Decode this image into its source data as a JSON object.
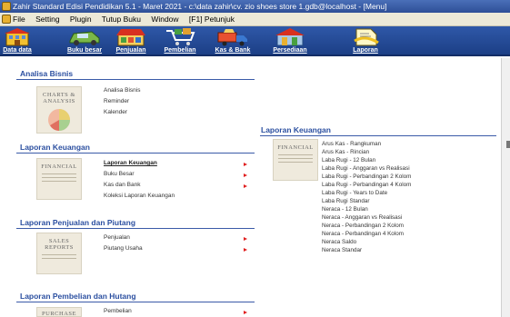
{
  "window": {
    "title": "Zahir Standard Edisi Pendidikan 5.1 - Maret 2021 - c:\\data zahir\\cv. zio shoes store 1.gdb@localhost - [Menu]"
  },
  "menu": [
    "File",
    "Setting",
    "Plugin",
    "Tutup Buku",
    "Window",
    "[F1] Petunjuk"
  ],
  "toolbar": [
    {
      "label": "Data data",
      "icon": "building-icon"
    },
    {
      "label": "Buku besar",
      "icon": "car-icon"
    },
    {
      "label": "Penjualan",
      "icon": "shop-icon"
    },
    {
      "label": "Pembelian",
      "icon": "cart-icon"
    },
    {
      "label": "Kas & Bank",
      "icon": "truck-icon"
    },
    {
      "label": "Persediaan",
      "icon": "warehouse-icon"
    },
    {
      "label": "Laporan",
      "icon": "document-icon"
    }
  ],
  "sections": {
    "analisa": {
      "title": "Analisa Bisnis",
      "thumb": "CHARTS & ANALYSIS",
      "items": [
        "Analisa Bisnis",
        "Reminder",
        "Kalender"
      ]
    },
    "keuangan": {
      "title": "Laporan Keuangan",
      "thumb": "FINANCIAL",
      "items": [
        "Laporan Keuangan",
        "Buku Besar",
        "Kas dan Bank",
        "Koleksi Laporan Keuangan"
      ]
    },
    "penjualan": {
      "title": "Laporan Penjualan dan Piutang",
      "thumb": "SALES REPORTS",
      "items": [
        "Penjualan",
        "Piutang Usaha"
      ]
    },
    "pembelian": {
      "title": "Laporan Pembelian dan Hutang",
      "thumb": "PURCHASE",
      "items": [
        "Pembelian"
      ]
    },
    "keuangan_right": {
      "title": "Laporan Keuangan",
      "thumb": "FINANCIAL",
      "items": [
        "Arus Kas - Rangkuman",
        "Arus Kas - Rincian",
        "Laba Rugi - 12 Bulan",
        "Laba Rugi - Anggaran vs Realisasi",
        "Laba Rugi - Perbandingan 2 Kolom",
        "Laba Rugi - Perbandingan 4 Kolom",
        "Laba Rugi - Years to Date",
        "Laba Rugi Standar",
        "Neraca - 12 Bulan",
        "Neraca - Anggaran vs Realisasi",
        "Neraca - Perbandingan 2 Kolom",
        "Neraca - Perbandingan 4 Kolom",
        "Neraca Saldo",
        "Neraca Standar"
      ]
    }
  },
  "colors": {
    "section_title": "#2b4fa0",
    "toolbar_bg": "#2f58a8",
    "arrow": "#e02020"
  }
}
